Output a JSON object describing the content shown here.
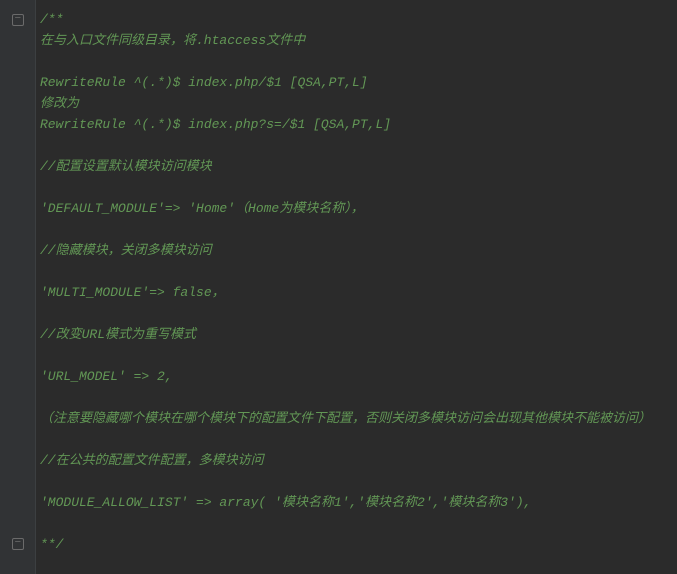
{
  "code": {
    "lines": [
      "/**",
      "在与入口文件同级目录，将.htaccess文件中",
      "",
      "RewriteRule ^(.*)$ index.php/$1 [QSA,PT,L]",
      "修改为",
      "RewriteRule ^(.*)$ index.php?s=/$1 [QSA,PT,L]",
      "",
      "//配置设置默认模块访问模块",
      "",
      "'DEFAULT_MODULE'=> 'Home'（Home为模块名称），",
      "",
      "//隐藏模块，关闭多模块访问",
      "",
      "'MULTI_MODULE'=> false，",
      "",
      "//改变URL模式为重写模式",
      "",
      "'URL_MODEL' => 2,",
      "",
      "（注意要隐藏哪个模块在哪个模块下的配置文件下配置，否则关闭多模块访问会出现其他模块不能被访问）",
      "",
      "//在公共的配置文件配置，多模块访问",
      "",
      "'MODULE_ALLOW_LIST' => array( '模块名称1','模块名称2','模块名称3'),",
      "",
      "**/"
    ]
  }
}
